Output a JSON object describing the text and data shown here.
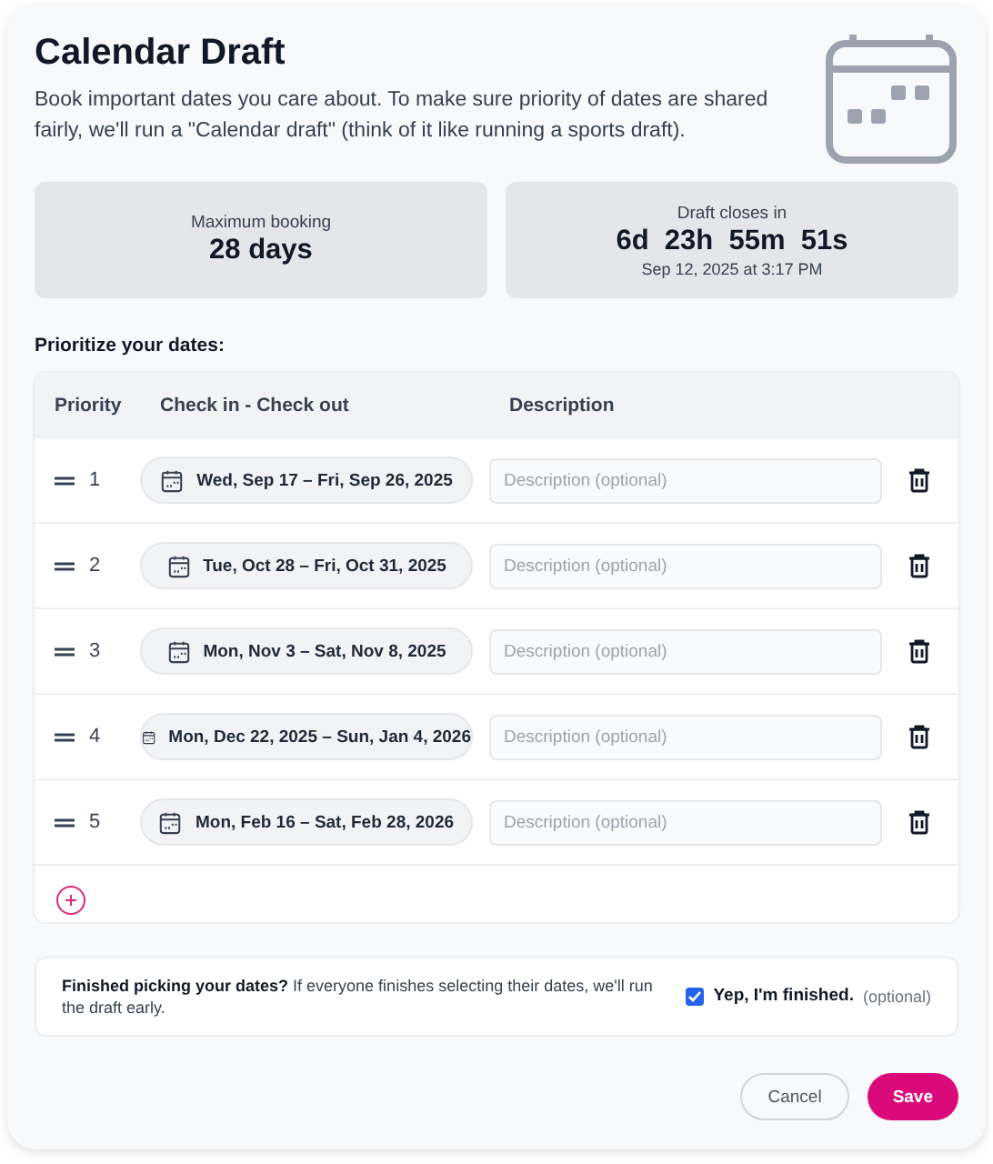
{
  "header": {
    "title": "Calendar Draft",
    "description": "Book important dates you care about. To make sure priority of dates are shared fairly, we'll run a \"Calendar draft\" (think of it like running a sports draft)."
  },
  "stats": [
    {
      "label": "Maximum booking",
      "value": "28 days"
    },
    {
      "label": "Draft closes in",
      "value": "6d  23h  55m  51s",
      "detail": "Sep 12, 2025 at 3:17 PM"
    }
  ],
  "section_title": "Prioritize your dates:",
  "table": {
    "columns": [
      "Priority",
      "Check in - Check out",
      "Description"
    ],
    "rows": [
      {
        "priority": "1",
        "dates": "Wed, Sep 17 – Fri, Sep 26, 2025",
        "placeholder": "Description (optional)"
      },
      {
        "priority": "2",
        "dates": "Tue, Oct 28 – Fri, Oct 31, 2025",
        "placeholder": "Description (optional)"
      },
      {
        "priority": "3",
        "dates": "Mon, Nov 3 – Sat, Nov 8, 2025",
        "placeholder": "Description (optional)"
      },
      {
        "priority": "4",
        "dates": "Mon, Dec 22, 2025 – Sun, Jan 4, 2026",
        "placeholder": "Description (optional)"
      },
      {
        "priority": "5",
        "dates": "Mon, Feb 16 – Sat, Feb 28, 2026",
        "placeholder": "Description (optional)"
      }
    ]
  },
  "finished": {
    "message": "**Finished picking your dates?** If everyone finishes selecting their dates, we'll run the draft early.",
    "checkbox": {
      "label": "Yep, I'm finished.",
      "hint": "(optional)",
      "checked": true
    }
  },
  "buttons": [
    {
      "label": "Cancel",
      "kind": "secondary"
    },
    {
      "label": "Save",
      "kind": "primary"
    }
  ]
}
